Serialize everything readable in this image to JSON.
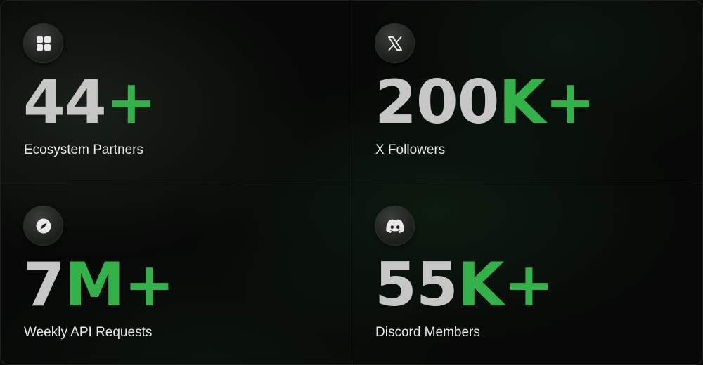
{
  "colors": {
    "background": "#070807",
    "number": "#c6c6c6",
    "accent": "#33b24a",
    "label": "#e6e6e6",
    "icon": "#e8e8e8"
  },
  "stats": [
    {
      "icon": "grid-icon",
      "number": "44",
      "accent": "+",
      "label": "Ecosystem Partners"
    },
    {
      "icon": "x-logo-icon",
      "number": "200",
      "accent": "K+",
      "label": "X Followers"
    },
    {
      "icon": "compass-icon",
      "number": "7",
      "accent": "M+",
      "label": "Weekly API Requests"
    },
    {
      "icon": "discord-icon",
      "number": "55",
      "accent": "K+",
      "label": "Discord Members"
    }
  ]
}
